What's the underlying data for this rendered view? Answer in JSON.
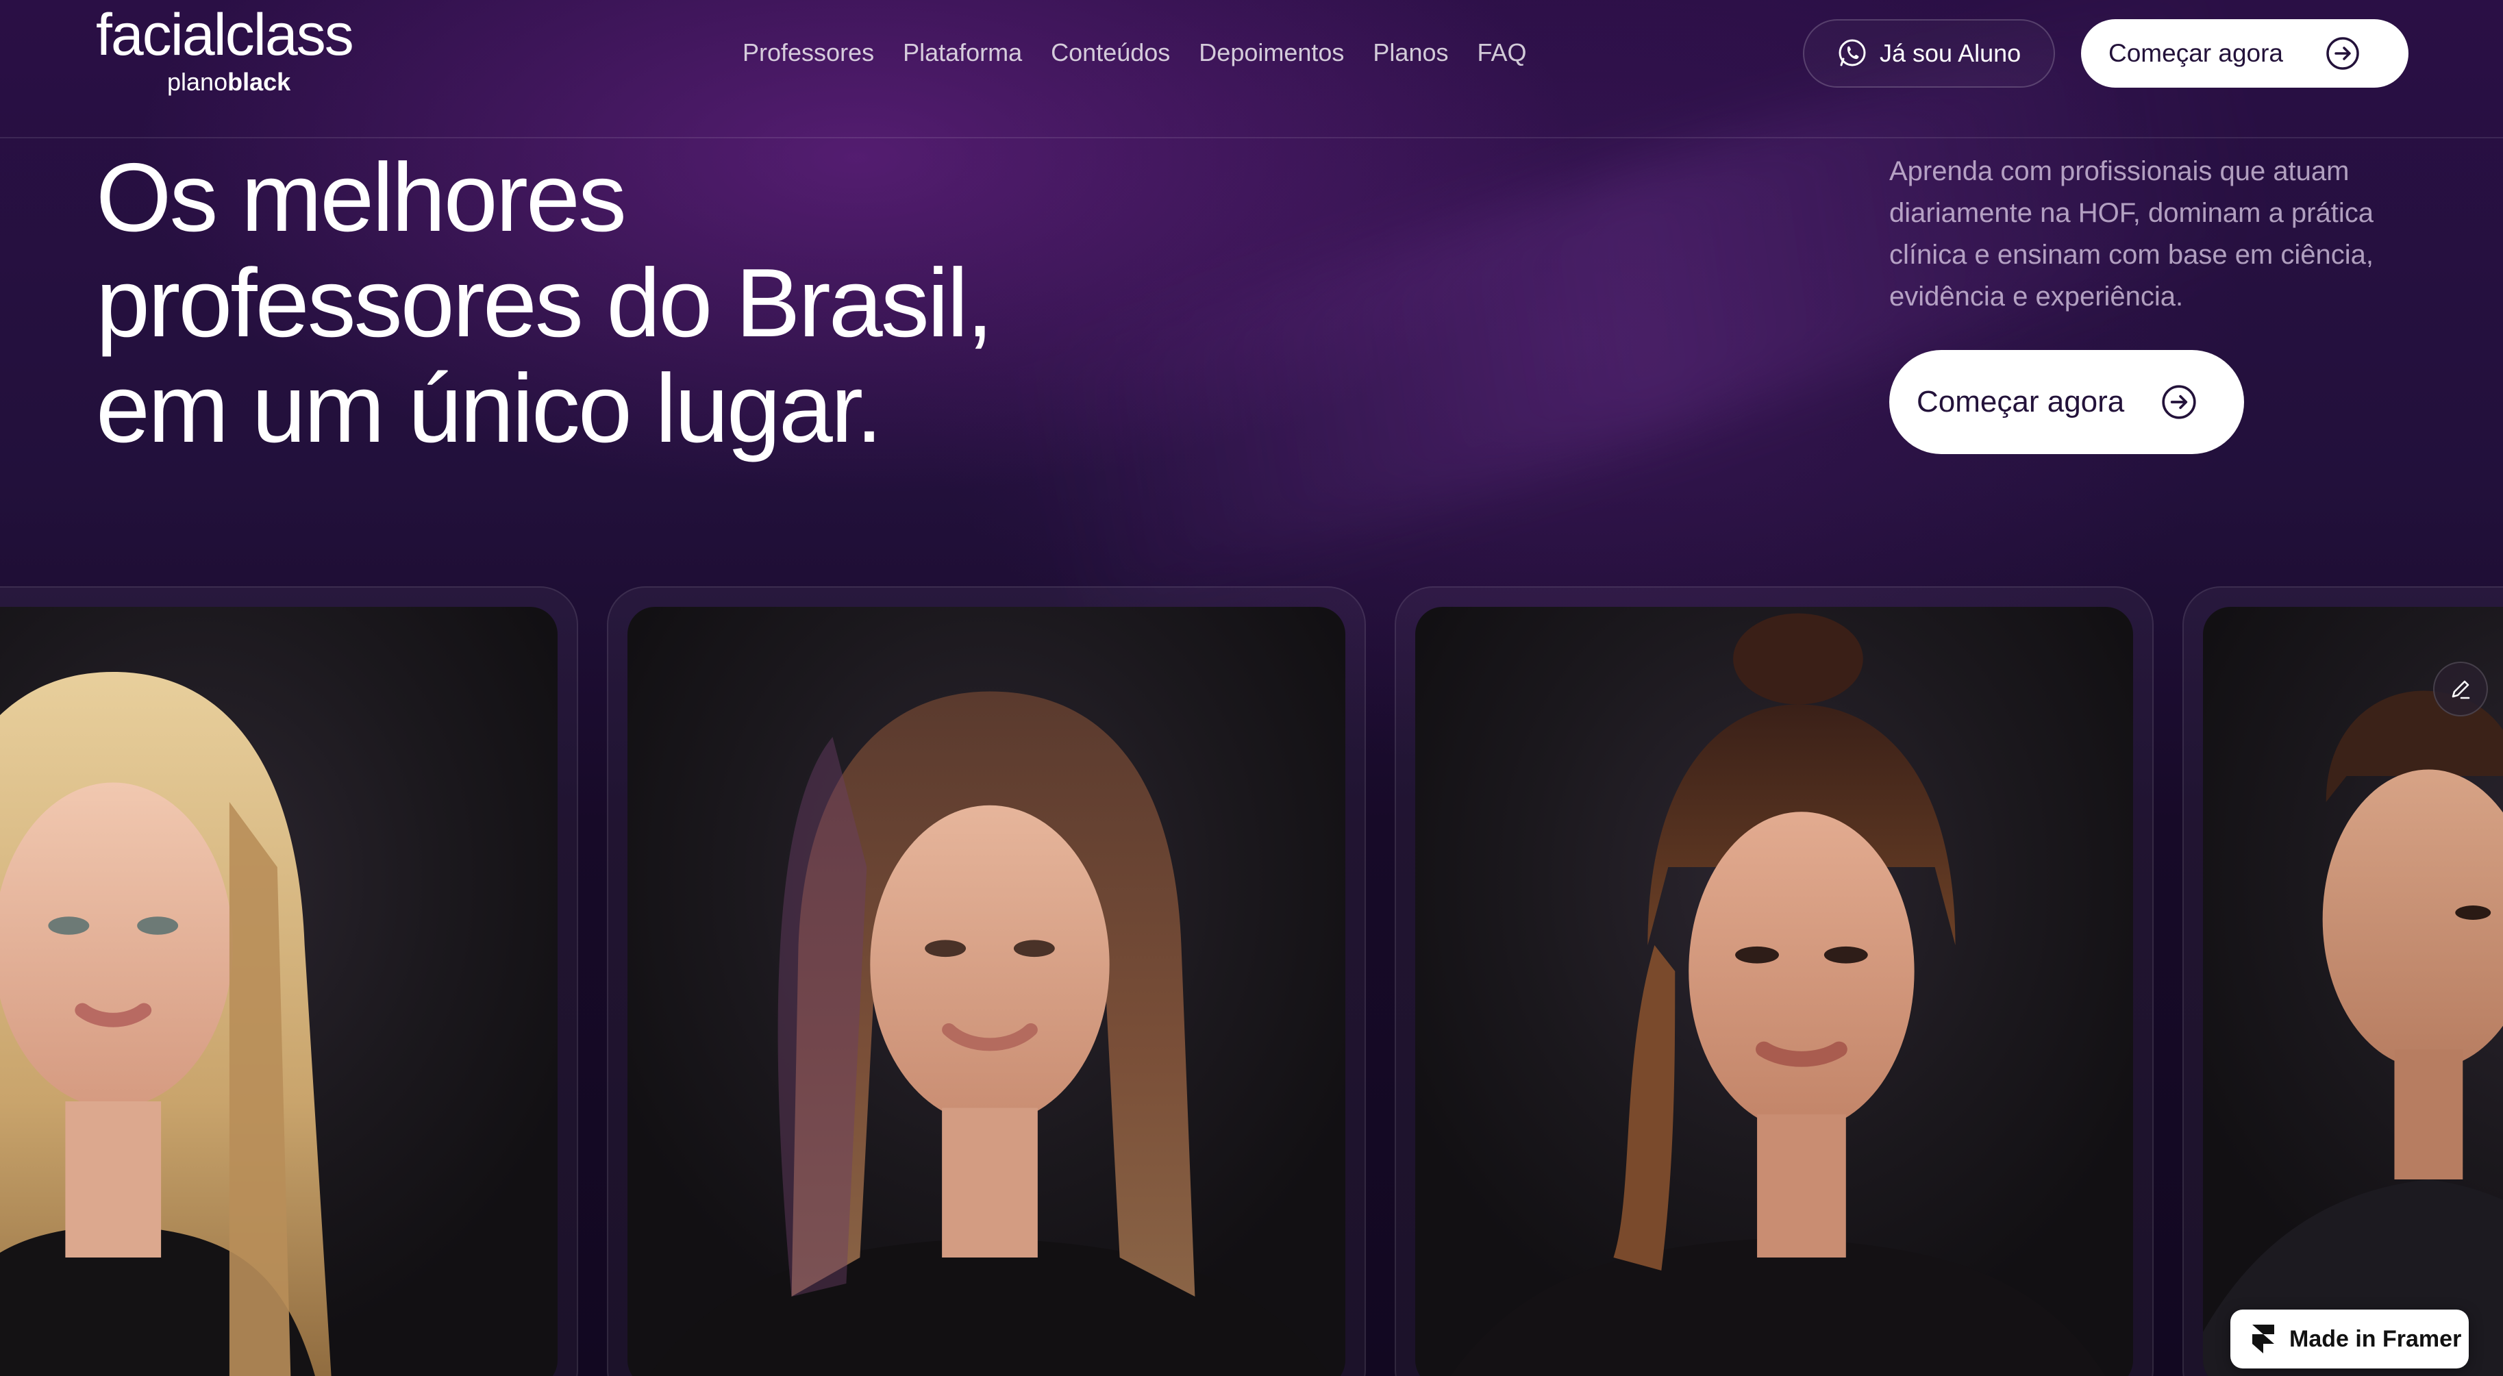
{
  "brand": {
    "logo_part1": "facial",
    "logo_part2": "class",
    "sub_part1": "plano",
    "sub_part2": "black"
  },
  "nav": {
    "links": [
      "Professores",
      "Plataforma",
      "Conteúdos",
      "Depoimentos",
      "Planos",
      "FAQ"
    ],
    "student_button": "Já sou Aluno",
    "cta_button": "Começar agora"
  },
  "hero": {
    "title_line1": "Os melhores",
    "title_line2": "professores do Brasil,",
    "title_line3": "em um único lugar.",
    "description": "Aprenda com profissionais que atuam diariamente na HOF, dominam a prática clínica e ensinam com base em ciência, evidência e experiência.",
    "cta_button": "Começar agora"
  },
  "carousel": {
    "cards": [
      {
        "icon": "portrait-blonde-woman"
      },
      {
        "icon": "portrait-brown-hair-woman"
      },
      {
        "icon": "portrait-dark-hair-woman"
      },
      {
        "icon": "portrait-man-in-suit"
      }
    ]
  },
  "badge": {
    "label": "Made in Framer"
  },
  "colors": {
    "background": "#1a0a2e",
    "accent_purple": "#2a0f45",
    "button_bg": "#ffffff",
    "button_text": "#23123a"
  }
}
